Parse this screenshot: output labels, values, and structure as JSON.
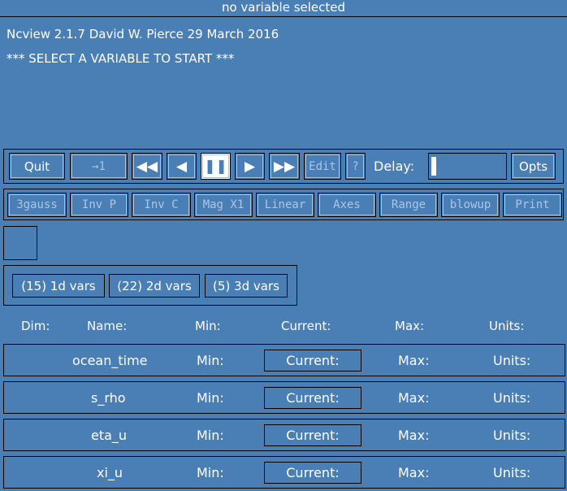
{
  "title": "no variable selected",
  "info": {
    "version": "Ncview 2.1.7 David W. Pierce  29 March 2016",
    "message": "*** SELECT A VARIABLE TO START ***"
  },
  "toolbar": {
    "quit": "Quit",
    "reset": "→1",
    "rewind_icon": "fast-backward",
    "back_icon": "step-back",
    "pause_icon": "pause",
    "forward_icon": "step-forward",
    "fastforward_icon": "fast-forward",
    "edit": "Edit",
    "help": "?",
    "delay_label": "Delay:",
    "opts": "Opts"
  },
  "options_row": [
    "3gauss",
    "Inv P",
    "Inv C",
    "Mag X1",
    "Linear",
    "Axes",
    "Range",
    "blowup",
    "Print"
  ],
  "var_groups": [
    "(15) 1d vars",
    "(22) 2d vars",
    "(5) 3d vars"
  ],
  "columns": {
    "dim": "Dim:",
    "name": "Name:",
    "min": "Min:",
    "current": "Current:",
    "max": "Max:",
    "units": "Units:"
  },
  "dimensions": [
    {
      "name": "ocean_time",
      "min": "Min:",
      "current": "Current:",
      "max": "Max:",
      "units": "Units:"
    },
    {
      "name": "s_rho",
      "min": "Min:",
      "current": "Current:",
      "max": "Max:",
      "units": "Units:"
    },
    {
      "name": "eta_u",
      "min": "Min:",
      "current": "Current:",
      "max": "Max:",
      "units": "Units:"
    },
    {
      "name": "xi_u",
      "min": "Min:",
      "current": "Current:",
      "max": "Max:",
      "units": "Units:"
    }
  ],
  "colors": {
    "background": "#4a7fb6",
    "text": "#ffffff",
    "disabled": "#a9c6e6"
  }
}
